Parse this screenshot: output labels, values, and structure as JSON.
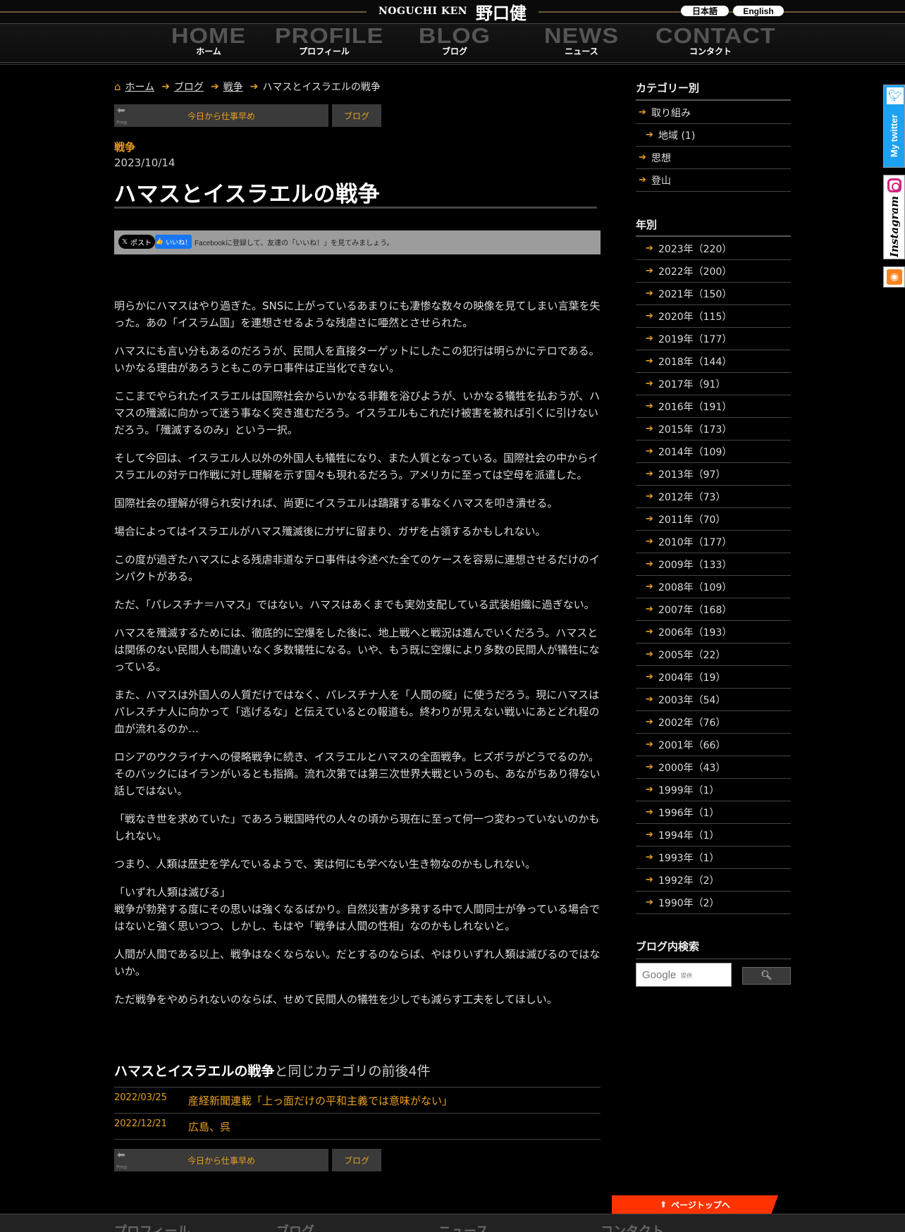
{
  "header": {
    "logo_en": "NOGUCHI KEN",
    "logo_jp": "野口健",
    "lang_ja": "日本語",
    "lang_en": "English",
    "nav": [
      {
        "en": "HOME",
        "jp": "ホーム"
      },
      {
        "en": "PROFILE",
        "jp": "プロフィール"
      },
      {
        "en": "BLOG",
        "jp": "ブログ"
      },
      {
        "en": "NEWS",
        "jp": "ニュース"
      },
      {
        "en": "CONTACT",
        "jp": "コンタクト"
      }
    ]
  },
  "breadcrumb": {
    "home": "ホーム",
    "blog": "ブログ",
    "category": "戦争",
    "current": "ハマスとイスラエルの戦争"
  },
  "pager": {
    "prev_label": "Prep",
    "prev_title": "今日から仕事早め",
    "blog_label": "ブログ"
  },
  "post": {
    "category": "戦争",
    "date": "2023/10/14",
    "title": "ハマスとイスラエルの戦争",
    "tweet_label": "ポスト",
    "like_label": "いいね！",
    "fb_text": "Facebookに登録して、友達の「いいね！」を見てみましょう。",
    "paragraphs": [
      "明らかにハマスはやり過ぎた。SNSに上がっているあまりにも凄惨な数々の映像を見てしまい言葉を失った。あの「イスラム国」を連想させるような残虐さに唖然とさせられた。",
      "ハマスにも言い分もあるのだろうが、民間人を直接ターゲットにしたこの犯行は明らかにテロである。いかなる理由があろうともこのテロ事件は正当化できない。",
      "ここまでやられたイスラエルは国際社会からいかなる非難を浴びようが、いかなる犠牲を払おうが、ハマスの殲滅に向かって迷う事なく突き進むだろう。イスラエルもこれだけ被害を被れば引くに引けないだろう。「殲滅するのみ」という一択。",
      "そして今回は、イスラエル人以外の外国人も犠牲になり、また人質となっている。国際社会の中からイスラエルの対テロ作戦に対し理解を示す国々も現れるだろう。アメリカに至っては空母を派遣した。",
      "国際社会の理解が得られ安ければ、尚更にイスラエルは躊躇する事なくハマスを叩き潰せる。",
      "場合によってはイスラエルがハマス殲滅後にガザに留まり、ガザを占領するかもしれない。",
      "この度が過ぎたハマスによる残虐非道なテロ事件は今述べた全てのケースを容易に連想させるだけのインパクトがある。",
      "ただ、「パレスチナ＝ハマス」ではない。ハマスはあくまでも実効支配している武装組織に過ぎない。",
      "ハマスを殲滅するためには、徹底的に空爆をした後に、地上戦へと戦況は進んでいくだろう。ハマスとは関係のない民間人も間違いなく多数犠牲になる。いや、もう既に空爆により多数の民間人が犠牲になっている。",
      "また、ハマスは外国人の人質だけではなく、パレスチナ人を「人間の縦」に使うだろう。現にハマスはパレスチナ人に向かって「逃げるな」と伝えているとの報道も。終わりが見えない戦いにあとどれ程の血が流れるのか…",
      "ロシアのウクライナへの侵略戦争に続き、イスラエルとハマスの全面戦争。ヒズボラがどうでるのか。そのバックにはイランがいるとも指摘。流れ次第では第三次世界大戦というのも、あながちあり得ない話しではない。",
      "「戦なき世を求めていた」であろう戦国時代の人々の頃から現在に至って何一つ変わっていないのかもしれない。",
      "つまり、人類は歴史を学んでいるようで、実は何にも学べない生き物なのかもしれない。",
      "「いずれ人類は滅びる」\n戦争が勃発する度にその思いは強くなるばかり。自然災害が多発する中で人間同士が争っている場合ではないと強く思いつつ、しかし、もはや「戦争は人間の性相」なのかもしれないと。",
      "人間が人間である以上、戦争はなくならない。だとするのならば、やはりいずれ人類は滅びるのではないか。",
      "ただ戦争をやめられないのならば、せめて民間人の犠牲を少しでも減らす工夫をしてほしい。"
    ]
  },
  "related": {
    "title_bold": "ハマスとイスラエルの戦争",
    "title_rest": "と同じカテゴリの前後4件",
    "items": [
      {
        "date": "2022/03/25",
        "title": "産経新聞連載「上っ面だけの平和主義では意味がない」"
      },
      {
        "date": "2022/12/21",
        "title": "広島、呉"
      }
    ]
  },
  "sidebar": {
    "category_heading": "カテゴリー別",
    "categories": [
      {
        "label": "取り組み",
        "sub": false
      },
      {
        "label": "地域 (1)",
        "sub": true
      },
      {
        "label": "思想",
        "sub": false
      },
      {
        "label": "登山",
        "sub": false
      }
    ],
    "year_heading": "年別",
    "years": [
      "2023年（220）",
      "2022年（200）",
      "2021年（150）",
      "2020年（115）",
      "2019年（177）",
      "2018年（144）",
      "2017年（91）",
      "2016年（191）",
      "2015年（173）",
      "2014年（109）",
      "2013年（97）",
      "2012年（73）",
      "2011年（70）",
      "2010年（177）",
      "2009年（133）",
      "2008年（109）",
      "2007年（168）",
      "2006年（193）",
      "2005年（22）",
      "2004年（19）",
      "2003年（54）",
      "2002年（76）",
      "2001年（66）",
      "2000年（43）",
      "1999年（1）",
      "1996年（1）",
      "1994年（1）",
      "1993年（1）",
      "1992年（2）",
      "1990年（2）"
    ],
    "search_heading": "ブログ内検索",
    "search_google": "Google",
    "search_provided": "提供"
  },
  "social_tabs": {
    "twitter": "My twitter",
    "instagram": "Instagram"
  },
  "footer": {
    "pagetop": "ページトップへ",
    "links": [
      "プロフィール",
      "ブログ",
      "ニュース",
      "コンタクト"
    ]
  },
  "colors": {
    "accent": "#e8a020",
    "pagetop": "#ff3300"
  }
}
